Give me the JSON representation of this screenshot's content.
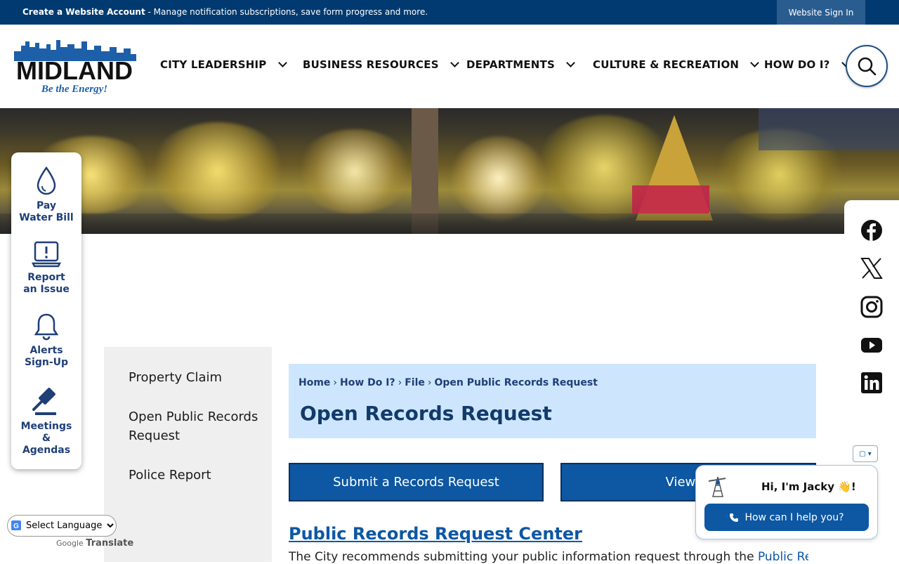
{
  "topbar": {
    "account_link": "Create a Website Account",
    "account_desc": " - Manage notification subscriptions, save form progress and more.",
    "sign_in": "Website Sign In"
  },
  "logo": {
    "name": "MIDLAND",
    "tagline": "Be the Energy!"
  },
  "nav": {
    "items": [
      {
        "label": "CITY LEADERSHIP"
      },
      {
        "label": "BUSINESS RESOURCES"
      },
      {
        "label": "DEPARTMENTS"
      },
      {
        "label": "CULTURE & RECREATION"
      },
      {
        "label": "HOW DO I?"
      }
    ],
    "search_icon": "search-icon"
  },
  "quick_links": [
    {
      "line1": "Pay",
      "line2": "Water Bill",
      "icon": "water-drop-icon"
    },
    {
      "line1": "Report",
      "line2": "an Issue",
      "icon": "laptop-alert-icon"
    },
    {
      "line1": "Alerts",
      "line2": "Sign-Up",
      "icon": "bell-icon"
    },
    {
      "line1": "Meetings",
      "line2": "&",
      "line3": "Agendas",
      "icon": "gavel-icon"
    }
  ],
  "social": [
    "facebook-icon",
    "x-icon",
    "instagram-icon",
    "youtube-icon",
    "linkedin-icon"
  ],
  "sidenav": {
    "items": [
      {
        "label": "Property Claim"
      },
      {
        "label": "Open Public Records Request"
      },
      {
        "label": "Police Report"
      }
    ]
  },
  "breadcrumb": [
    "Home",
    "How Do I?",
    "File",
    "Open Public Records Request"
  ],
  "page_title": "Open Records Request",
  "buttons": {
    "submit": "Submit a Records Request",
    "view": "View Fr"
  },
  "records_center": {
    "title": "Public Records Request Center",
    "text": "The City recommends submitting your public information request through the ",
    "link": "Public Records"
  },
  "chat": {
    "greeting": "Hi, I'm Jacky 👋!",
    "help": "How can I help you?"
  },
  "translate": {
    "select": "Select Language",
    "powered_by": "Google",
    "translate_label": "Translate"
  },
  "colors": {
    "primary": "#0d57a3",
    "topbar": "#003a70",
    "title_bg": "#cde6fd"
  }
}
